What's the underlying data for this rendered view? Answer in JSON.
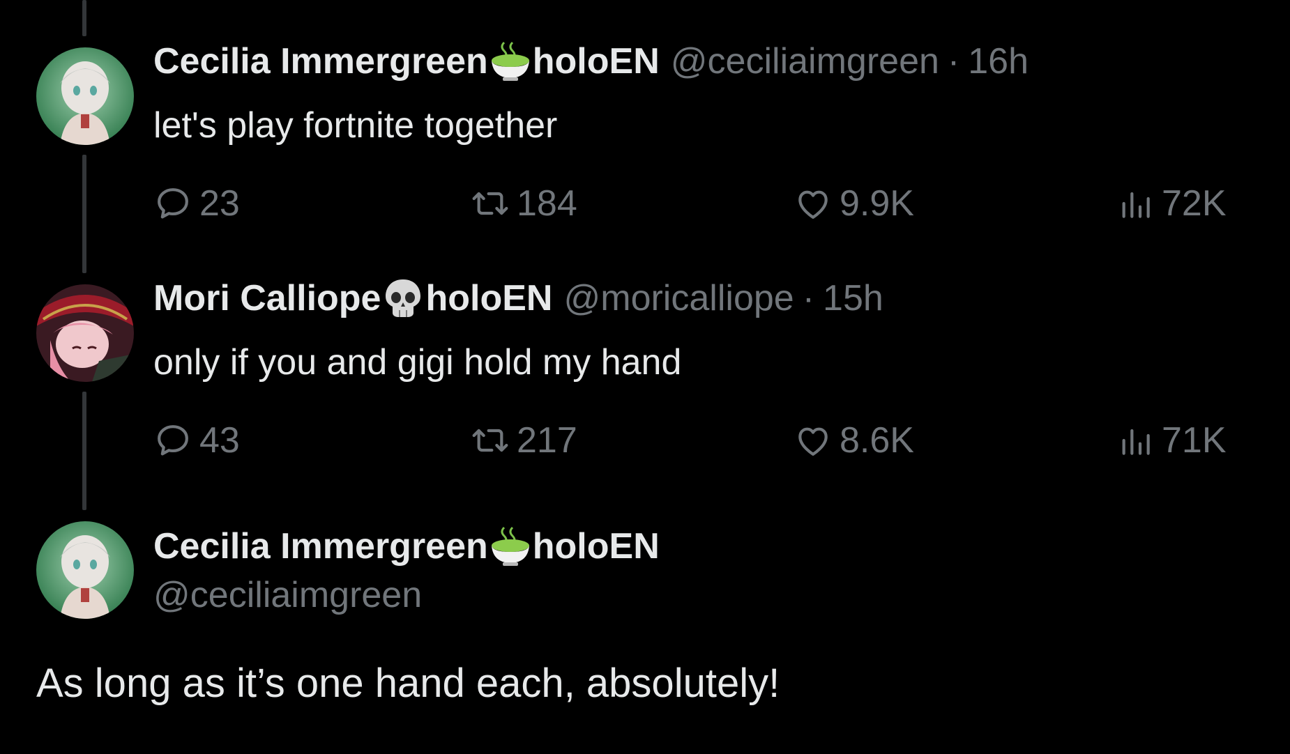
{
  "tweets": [
    {
      "display_name": "Cecilia Immergreen",
      "name_emoji": "matcha-tea-emoji",
      "name_suffix": "holoEN",
      "handle": "@ceciliaimgreen",
      "separator": "·",
      "time": "16h",
      "text": "let's play fortnite together",
      "replies": "23",
      "reposts": "184",
      "likes": "9.9K",
      "views": "72K"
    },
    {
      "display_name": "Mori Calliope",
      "name_emoji": "skull-emoji",
      "name_suffix": "holoEN",
      "handle": "@moricalliope",
      "separator": "·",
      "time": "15h",
      "text": "only if you and gigi hold my hand",
      "replies": "43",
      "reposts": "217",
      "likes": "8.6K",
      "views": "71K"
    }
  ],
  "main_tweet": {
    "display_name": "Cecilia Immergreen",
    "name_emoji": "matcha-tea-emoji",
    "name_suffix": "holoEN",
    "handle": "@ceciliaimgreen",
    "text": "As long as it’s one hand each, absolutely!"
  },
  "icons": {
    "reply": "reply-bubble-icon",
    "repost": "repost-arrows-icon",
    "like": "heart-icon",
    "views": "views-bar-chart-icon"
  },
  "colors": {
    "background": "#000000",
    "primary_text": "#e7e9ea",
    "secondary_text": "#71767b",
    "thread_line": "#333639"
  }
}
